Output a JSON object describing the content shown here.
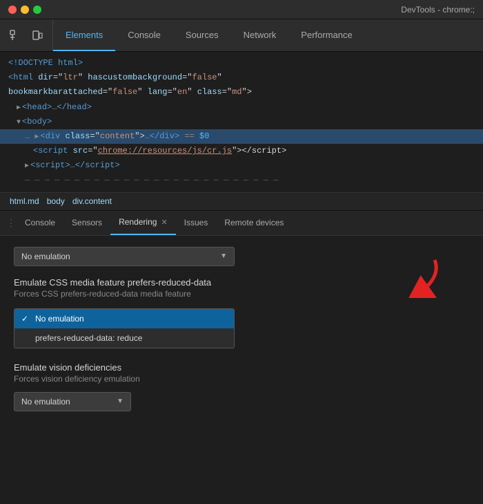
{
  "titleBar": {
    "title": "DevTools - chrome:;"
  },
  "toolbar": {
    "tabs": [
      {
        "label": "Elements",
        "active": true
      },
      {
        "label": "Console",
        "active": false
      },
      {
        "label": "Sources",
        "active": false
      },
      {
        "label": "Network",
        "active": false
      },
      {
        "label": "Performance",
        "active": false
      }
    ]
  },
  "domLines": [
    {
      "text": "<!DOCTYPE html>",
      "class": "",
      "indent": 0
    },
    {
      "html": true,
      "indent": 0
    },
    {
      "bookmarkbar": true,
      "indent": 0
    },
    {
      "body_open": true,
      "indent": 0
    },
    {
      "head": true,
      "indent": 1
    },
    {
      "body_tag": true,
      "indent": 1
    },
    {
      "div_content": true,
      "indent": 2,
      "highlighted": true
    },
    {
      "script_cr": true,
      "indent": 3
    },
    {
      "script_close": true,
      "indent": 2
    },
    {
      "partial": true,
      "indent": 2
    }
  ],
  "breadcrumb": {
    "items": [
      "html.md",
      "body",
      "div.content"
    ]
  },
  "panelTabs": [
    {
      "label": "Console",
      "active": false,
      "closeable": false
    },
    {
      "label": "Sensors",
      "active": false,
      "closeable": false
    },
    {
      "label": "Rendering",
      "active": true,
      "closeable": true
    },
    {
      "label": "Issues",
      "active": false,
      "closeable": false
    },
    {
      "label": "Remote devices",
      "active": false,
      "closeable": false
    }
  ],
  "rendering": {
    "dropdown1": {
      "value": "No emulation",
      "placeholder": "No emulation"
    },
    "section1": {
      "title": "Emulate CSS media feature prefers-reduced-data",
      "subtitle": "Forces CSS prefers-reduced-data media feature"
    },
    "dropdownOptions": [
      {
        "label": "No emulation",
        "selected": true
      },
      {
        "label": "prefers-reduced-data: reduce",
        "selected": false
      }
    ],
    "section2": {
      "title": "Emulate vision deficiencies",
      "subtitle": "Forces vision deficiency emulation"
    },
    "dropdown2": {
      "value": "No emulation",
      "placeholder": "No emulation"
    }
  }
}
